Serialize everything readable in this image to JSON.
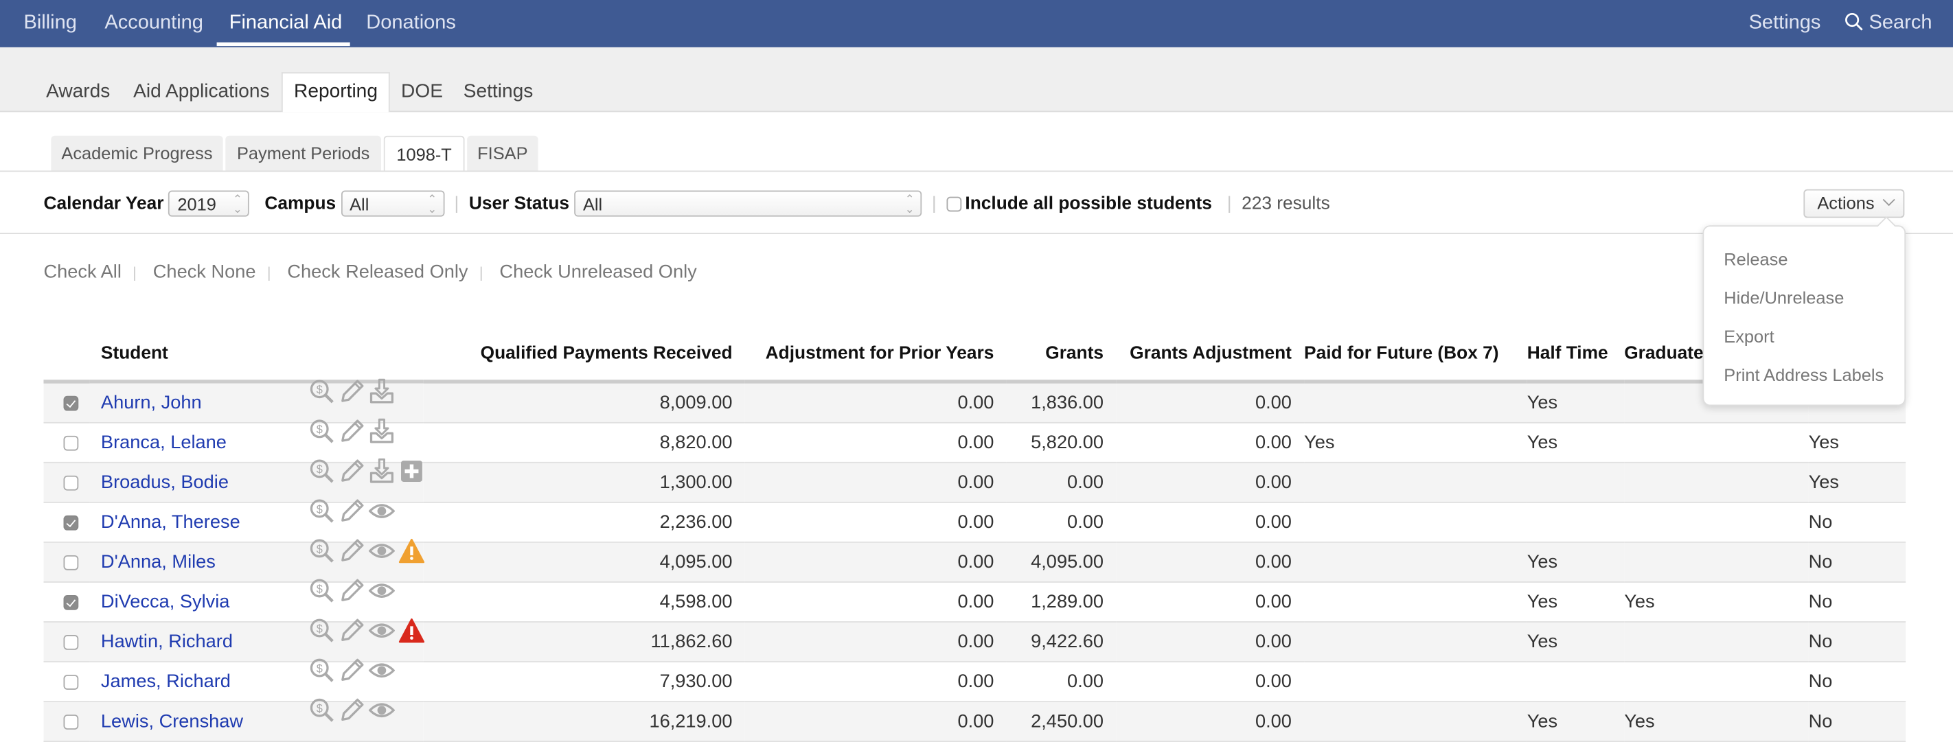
{
  "topnav": {
    "items": [
      "Billing",
      "Accounting",
      "Financial Aid",
      "Donations"
    ],
    "active": "Financial Aid",
    "settings": "Settings",
    "search": "Search"
  },
  "subnav": {
    "tabs": [
      "Awards",
      "Aid Applications",
      "Reporting",
      "DOE",
      "Settings"
    ],
    "active": "Reporting"
  },
  "reporting_tabs": {
    "tabs": [
      "Academic Progress",
      "Payment Periods",
      "1098-T",
      "FISAP"
    ],
    "active": "1098-T"
  },
  "filters": {
    "calendar_year_label": "Calendar Year",
    "calendar_year": "2019",
    "campus_label": "Campus",
    "campus": "All",
    "user_status_label": "User Status",
    "user_status": "All",
    "include_label": "Include all possible students",
    "include_checked": false,
    "results": "223 results"
  },
  "actions": {
    "label": "Actions",
    "menu": [
      "Release",
      "Hide/Unrelease",
      "Export",
      "Print Address Labels"
    ]
  },
  "checks": [
    "Check All",
    "Check None",
    "Check Released Only",
    "Check Unreleased Only"
  ],
  "table": {
    "headers": [
      "Student",
      "Qualified Payments Received",
      "Adjustment for Prior Years",
      "Grants",
      "Grants Adjustment",
      "Paid for Future (Box 7)",
      "Half Time",
      "Graduate",
      ""
    ],
    "rows": [
      {
        "checked": true,
        "name": "Ahurn, John",
        "icons": [
          "dollar-search",
          "pencil",
          "download"
        ],
        "qpr": "8,009.00",
        "adj": "0.00",
        "grants": "1,836.00",
        "gadj": "0.00",
        "paid": "",
        "half": "Yes",
        "grad": "",
        "last": ""
      },
      {
        "checked": false,
        "name": "Branca, Lelane",
        "icons": [
          "dollar-search",
          "pencil",
          "download"
        ],
        "qpr": "8,820.00",
        "adj": "0.00",
        "grants": "5,820.00",
        "gadj": "0.00",
        "paid": "Yes",
        "half": "Yes",
        "grad": "",
        "last": "Yes"
      },
      {
        "checked": false,
        "name": "Broadus, Bodie",
        "icons": [
          "dollar-search",
          "pencil",
          "download",
          "plus"
        ],
        "qpr": "1,300.00",
        "adj": "0.00",
        "grants": "0.00",
        "gadj": "0.00",
        "paid": "",
        "half": "",
        "grad": "",
        "last": "Yes"
      },
      {
        "checked": true,
        "name": "D'Anna, Therese",
        "icons": [
          "dollar-search",
          "pencil",
          "eye"
        ],
        "qpr": "2,236.00",
        "adj": "0.00",
        "grants": "0.00",
        "gadj": "0.00",
        "paid": "",
        "half": "",
        "grad": "",
        "last": "No"
      },
      {
        "checked": false,
        "name": "D'Anna, Miles",
        "icons": [
          "dollar-search",
          "pencil",
          "eye",
          "warning-orange"
        ],
        "qpr": "4,095.00",
        "adj": "0.00",
        "grants": "4,095.00",
        "gadj": "0.00",
        "paid": "",
        "half": "Yes",
        "grad": "",
        "last": "No"
      },
      {
        "checked": true,
        "name": "DiVecca, Sylvia",
        "icons": [
          "dollar-search",
          "pencil",
          "eye"
        ],
        "qpr": "4,598.00",
        "adj": "0.00",
        "grants": "1,289.00",
        "gadj": "0.00",
        "paid": "",
        "half": "Yes",
        "grad": "Yes",
        "last": "No"
      },
      {
        "checked": false,
        "name": "Hawtin, Richard",
        "icons": [
          "dollar-search",
          "pencil",
          "eye",
          "warning-red"
        ],
        "qpr": "11,862.60",
        "adj": "0.00",
        "grants": "9,422.60",
        "gadj": "0.00",
        "paid": "",
        "half": "Yes",
        "grad": "",
        "last": "No"
      },
      {
        "checked": false,
        "name": "James, Richard",
        "icons": [
          "dollar-search",
          "pencil",
          "eye"
        ],
        "qpr": "7,930.00",
        "adj": "0.00",
        "grants": "0.00",
        "gadj": "0.00",
        "paid": "",
        "half": "",
        "grad": "",
        "last": "No"
      },
      {
        "checked": false,
        "name": "Lewis, Crenshaw",
        "icons": [
          "dollar-search",
          "pencil",
          "eye"
        ],
        "qpr": "16,219.00",
        "adj": "0.00",
        "grants": "2,450.00",
        "gadj": "0.00",
        "paid": "",
        "half": "Yes",
        "grad": "Yes",
        "last": "No"
      }
    ]
  },
  "colors": {
    "topbar": "#3f5a93",
    "link": "#1f3bb0",
    "icon": "#aaaaaa",
    "warning_orange": "#f0a030",
    "warning_red": "#d9291c"
  }
}
